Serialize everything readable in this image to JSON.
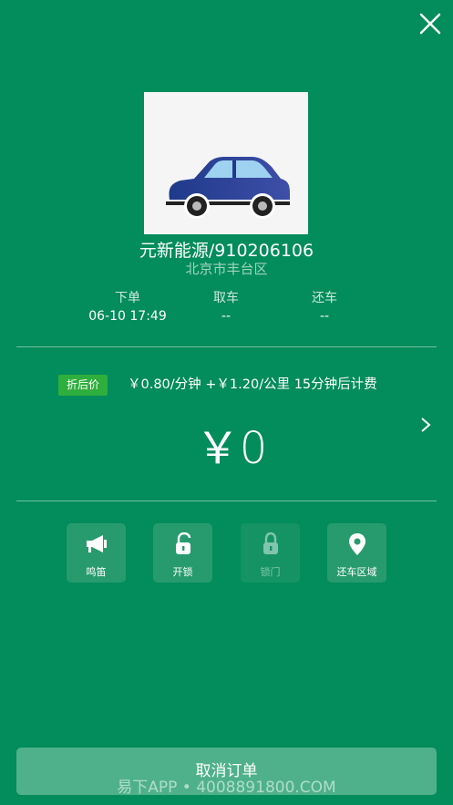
{
  "car": {
    "title": "元新能源/910206106",
    "location": "北京市丰台区"
  },
  "order_info": [
    {
      "label": "下单",
      "value": "06-10 17:49"
    },
    {
      "label": "取车",
      "value": "--"
    },
    {
      "label": "还车",
      "value": "--"
    }
  ],
  "pricing": {
    "badge": "折后价",
    "rule": "￥0.80/分钟 +￥1.20/公里 15分钟后计费",
    "amount": "￥0"
  },
  "actions": [
    {
      "label": "鸣笛",
      "icon": "horn-icon",
      "enabled": true
    },
    {
      "label": "开锁",
      "icon": "unlock-icon",
      "enabled": true
    },
    {
      "label": "锁门",
      "icon": "lock-icon",
      "enabled": false
    },
    {
      "label": "还车区域",
      "icon": "location-pin-icon",
      "enabled": true
    }
  ],
  "cancel_button": "取消订单",
  "watermark": "易下APP • 4008891800.COM",
  "colors": {
    "background": "#038c5c",
    "badge": "#2eae3c",
    "action_button": "#279b6e",
    "cancel_button": "#4fb18b"
  }
}
